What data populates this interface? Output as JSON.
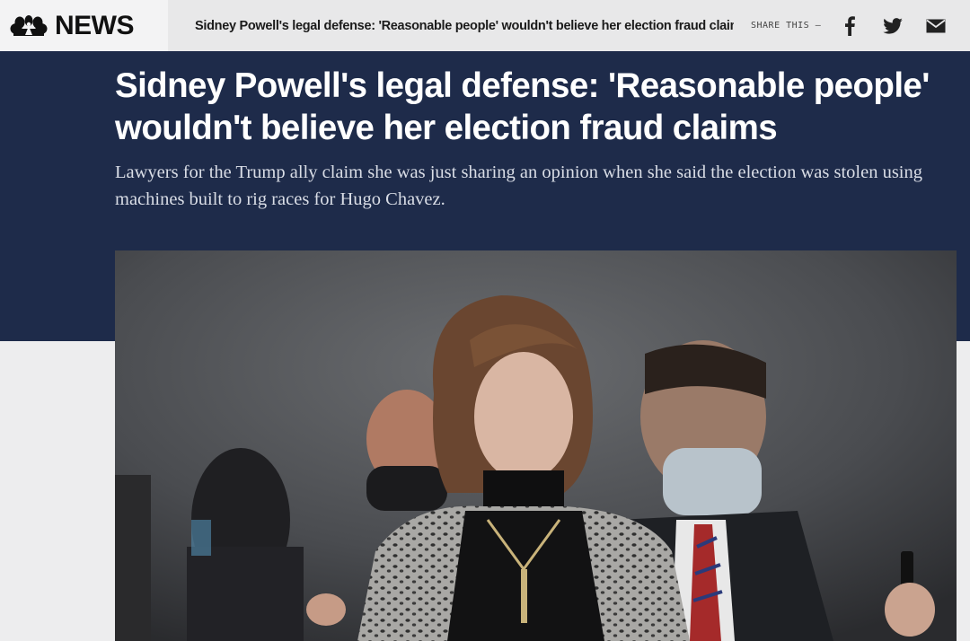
{
  "brand": {
    "logo_text": "NEWS",
    "logo_icon": "nbc-peacock-icon"
  },
  "sticky_bar": {
    "headline": "Sidney Powell's legal defense: 'Reasonable people' wouldn't believe her election fraud claims",
    "share_label": "SHARE THIS —",
    "share_icons": [
      "facebook-icon",
      "twitter-icon",
      "email-icon"
    ]
  },
  "article": {
    "headline": "Sidney Powell's legal defense: 'Reasonable people' wouldn't believe her election fraud claims",
    "dek": "Lawyers for the Trump ally claim she was just sharing an opinion when she said the election was stolen using machines built to rig races for Hugo Chavez."
  },
  "colors": {
    "hero_bg": "#1e2b4a",
    "page_bg": "#ededee",
    "bar_bg": "#e8e8e9"
  }
}
